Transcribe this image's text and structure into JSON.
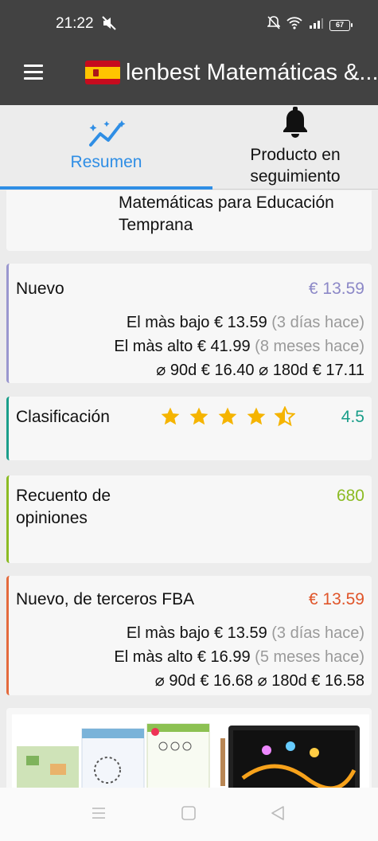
{
  "status": {
    "time": "21:22",
    "battery": "67"
  },
  "appbar": {
    "title": "lenbest Matemáticas &..."
  },
  "tabs": [
    {
      "label": "Resumen"
    },
    {
      "label": "Producto en seguimiento"
    }
  ],
  "category": {
    "text": "Matemáticas para Educación Temprana"
  },
  "new": {
    "label": "Nuevo",
    "price": "€ 13.59",
    "low_label": "El màs bajo",
    "low_price": "€ 13.59",
    "low_when": "(3 días hace)",
    "high_label": "El màs alto",
    "high_price": "€ 41.99",
    "high_when": "(8 meses hace)",
    "avg90_label": "⌀ 90d",
    "avg90": "€ 16.40",
    "avg180_label": "⌀ 180d",
    "avg180": "€ 17.11"
  },
  "rating": {
    "label": "Clasificación",
    "value": "4.5",
    "stars": 4.5
  },
  "reviews": {
    "label": "Recuento de opiniones",
    "value": "680"
  },
  "fba": {
    "label": "Nuevo, de terceros FBA",
    "price": "€ 13.59",
    "low_label": "El màs bajo",
    "low_price": "€ 13.59",
    "low_when": "(3 días hace)",
    "high_label": "El màs alto",
    "high_price": "€ 16.99",
    "high_when": "(5 meses hace)",
    "avg90_label": "⌀ 90d",
    "avg90": "€ 16.68",
    "avg180_label": "⌀ 180d",
    "avg180": "€ 16.58"
  },
  "colors": {
    "accent": "#2f8ee5",
    "new": "#8c88c7",
    "rating": "#1a9e8a",
    "reviews": "#8bbb23",
    "fba": "#e0552a",
    "star": "#f5b400"
  }
}
